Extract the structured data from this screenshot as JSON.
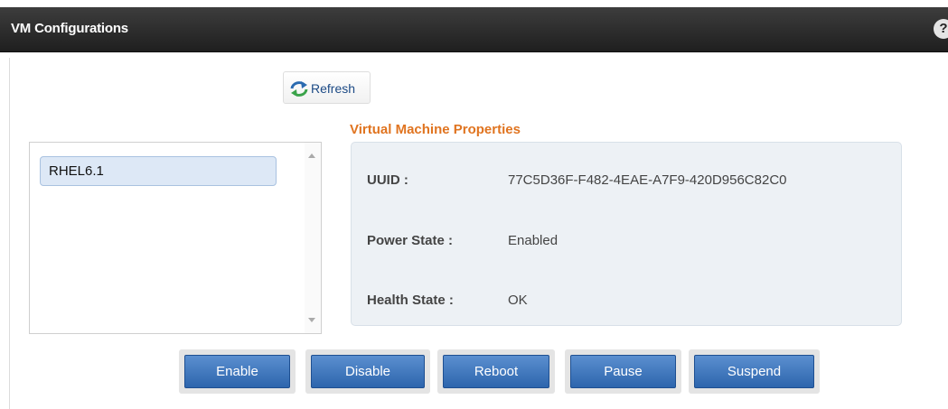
{
  "window": {
    "title": "VM Configurations",
    "help_label": "?"
  },
  "toolbar": {
    "refresh_label": "Refresh"
  },
  "vm_list": {
    "items": [
      {
        "label": "RHEL6.1",
        "selected": true
      }
    ]
  },
  "properties": {
    "heading": "Virtual Machine Properties",
    "rows": [
      {
        "label": "UUID :",
        "value": "77C5D36F-F482-4EAE-A7F9-420D956C82C0"
      },
      {
        "label": "Power State :",
        "value": "Enabled"
      },
      {
        "label": "Health State :",
        "value": "OK"
      }
    ]
  },
  "actions": {
    "enable": "Enable",
    "disable": "Disable",
    "reboot": "Reboot",
    "pause": "Pause",
    "suspend": "Suspend"
  },
  "colors": {
    "title_bar": "#2b2b2b",
    "heading_accent": "#e07420",
    "button_primary": "#3a72ba",
    "selection": "#dde8f6"
  },
  "icons": {
    "refresh": "refresh-icon",
    "help": "help-icon"
  }
}
